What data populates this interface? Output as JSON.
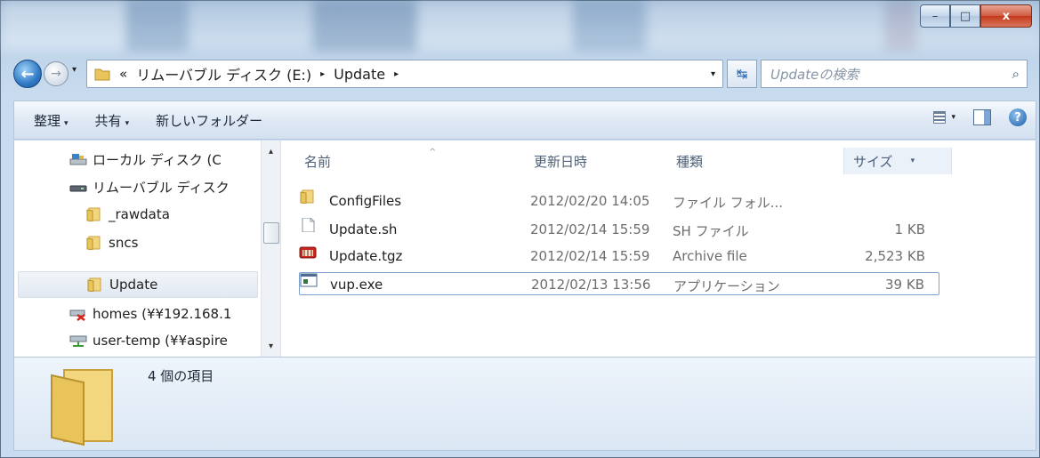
{
  "window_controls": {
    "minimize": "–",
    "maximize": "□",
    "close": "x"
  },
  "nav": {
    "back": "←",
    "forward": "→"
  },
  "address": {
    "prefix": "«",
    "crumbs": [
      "リムーバブル ディスク (E:)",
      "Update"
    ],
    "separator": "▸",
    "dropdown": "▾"
  },
  "search": {
    "placeholder": "Updateの検索"
  },
  "toolbar": {
    "organize": "整理",
    "share": "共有",
    "new_folder": "新しいフォルダー",
    "arrow": "▾",
    "help": "?"
  },
  "sidebar": {
    "items": [
      {
        "label": "ローカル ディスク (C",
        "icon": "local-disk-icon"
      },
      {
        "label": "リムーバブル ディスク",
        "icon": "removable-disk-icon"
      },
      {
        "label": "_rawdata",
        "icon": "folder-icon"
      },
      {
        "label": "sncs",
        "icon": "folder-icon"
      },
      {
        "label": "Update",
        "icon": "folder-icon",
        "selected": true
      },
      {
        "label": "homes (¥¥192.168.1",
        "icon": "disconnected-network-drive-icon"
      },
      {
        "label": "user-temp (¥¥aspire",
        "icon": "network-drive-icon"
      }
    ],
    "scroll_up": "▴",
    "scroll_down": "▾"
  },
  "columns": {
    "name": "名前",
    "date": "更新日時",
    "type": "種類",
    "size": "サイズ",
    "sort_arrow": "^"
  },
  "files": [
    {
      "name": "ConfigFiles",
      "date": "2012/02/20 14:05",
      "type": "ファイル フォル...",
      "size": "",
      "icon": "folder-icon"
    },
    {
      "name": "Update.sh",
      "date": "2012/02/14 15:59",
      "type": "SH ファイル",
      "size": "1 KB",
      "icon": "document-icon"
    },
    {
      "name": "Update.tgz",
      "date": "2012/02/14 15:59",
      "type": "Archive file",
      "size": "2,523 KB",
      "icon": "archive-icon"
    },
    {
      "name": "vup.exe",
      "date": "2012/02/13 13:56",
      "type": "アプリケーション",
      "size": "39 KB",
      "icon": "application-icon"
    }
  ],
  "details": {
    "count": "4 個の項目"
  },
  "colors": {
    "folder": "#e8c45a",
    "accent": "#2f79c5",
    "close": "#c43a1c"
  }
}
